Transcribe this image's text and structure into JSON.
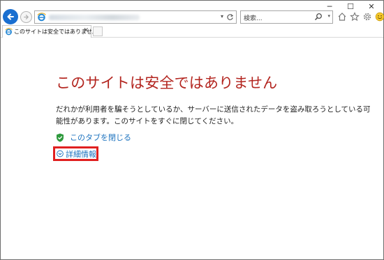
{
  "window": {
    "minimize": "─",
    "maximize": "☐",
    "close": "✕"
  },
  "nav": {
    "address_value": "",
    "search_placeholder": "検索..."
  },
  "tabs": [
    {
      "label": "このサイトは安全ではありません"
    }
  ],
  "page": {
    "title": "このサイトは安全ではありません",
    "description": "だれかが利用者を騙そうとしているか、サーバーに送信されたデータを盗み取ろうとしている可能性があります。このサイトをすぐに閉じてください。",
    "close_tab_label": "このタブを閉じる",
    "details_label": "詳細情報"
  },
  "colors": {
    "title": "#b3251f",
    "link": "#1b72bf",
    "highlight": "#e02020",
    "back_button": "#1a6fd0"
  },
  "icons": [
    "back-arrow-icon",
    "forward-arrow-icon",
    "ie-icon",
    "refresh-icon",
    "search-icon",
    "home-icon",
    "star-icon",
    "gear-icon",
    "smiley-icon",
    "shield-icon",
    "chevron-down-icon"
  ]
}
